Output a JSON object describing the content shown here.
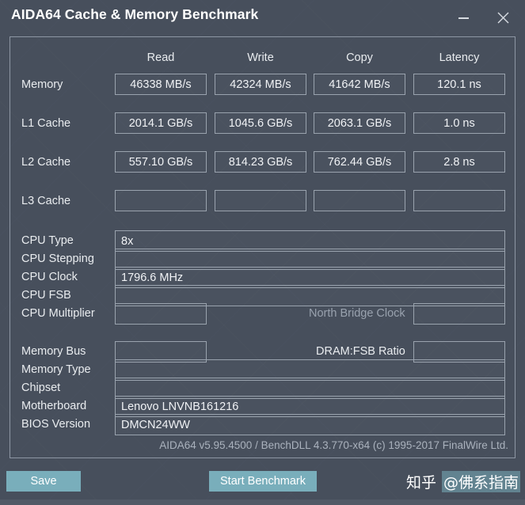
{
  "window": {
    "title": "AIDA64 Cache & Memory Benchmark",
    "minimize_label": "minimize",
    "close_label": "close"
  },
  "benchmark_table": {
    "columns": [
      "Read",
      "Write",
      "Copy",
      "Latency"
    ],
    "rows": [
      {
        "label": "Memory",
        "read": "46338 MB/s",
        "write": "42324 MB/s",
        "copy": "41642 MB/s",
        "latency": "120.1 ns"
      },
      {
        "label": "L1 Cache",
        "read": "2014.1 GB/s",
        "write": "1045.6 GB/s",
        "copy": "2063.1 GB/s",
        "latency": "1.0 ns"
      },
      {
        "label": "L2 Cache",
        "read": "557.10 GB/s",
        "write": "814.23 GB/s",
        "copy": "762.44 GB/s",
        "latency": "2.8 ns"
      },
      {
        "label": "L3 Cache",
        "read": "",
        "write": "",
        "copy": "",
        "latency": ""
      }
    ]
  },
  "cpu_info": {
    "cpu_type_label": "CPU Type",
    "cpu_type_value": "8x",
    "cpu_stepping_label": "CPU Stepping",
    "cpu_stepping_value": "",
    "cpu_clock_label": "CPU Clock",
    "cpu_clock_value": "1796.6 MHz",
    "cpu_fsb_label": "CPU FSB",
    "cpu_fsb_value": "",
    "cpu_multiplier_label": "CPU Multiplier",
    "cpu_multiplier_value": "",
    "north_bridge_clock_label": "North Bridge Clock",
    "north_bridge_clock_value": ""
  },
  "system_info": {
    "memory_bus_label": "Memory Bus",
    "memory_bus_value": "",
    "dram_fsb_ratio_label": "DRAM:FSB Ratio",
    "dram_fsb_ratio_value": "",
    "memory_type_label": "Memory Type",
    "memory_type_value": "",
    "chipset_label": "Chipset",
    "chipset_value": "",
    "motherboard_label": "Motherboard",
    "motherboard_value": "Lenovo LNVNB161216",
    "bios_version_label": "BIOS Version",
    "bios_version_value": "DMCN24WW"
  },
  "footer": {
    "version_text": "AIDA64 v5.95.4500 / BenchDLL 4.3.770-x64  (c) 1995-2017 FinalWire Ltd.",
    "save_label": "Save",
    "start_benchmark_label": "Start Benchmark"
  },
  "watermark": {
    "site": "知乎",
    "handle": "@佛系指南"
  },
  "colors": {
    "background": "#474f5c",
    "panel_border": "#8e97a4",
    "field_border": "#9aa3ae",
    "button_accent": "#79aebb",
    "text_primary": "#e9ecef",
    "text_dim": "#99a2ae"
  }
}
